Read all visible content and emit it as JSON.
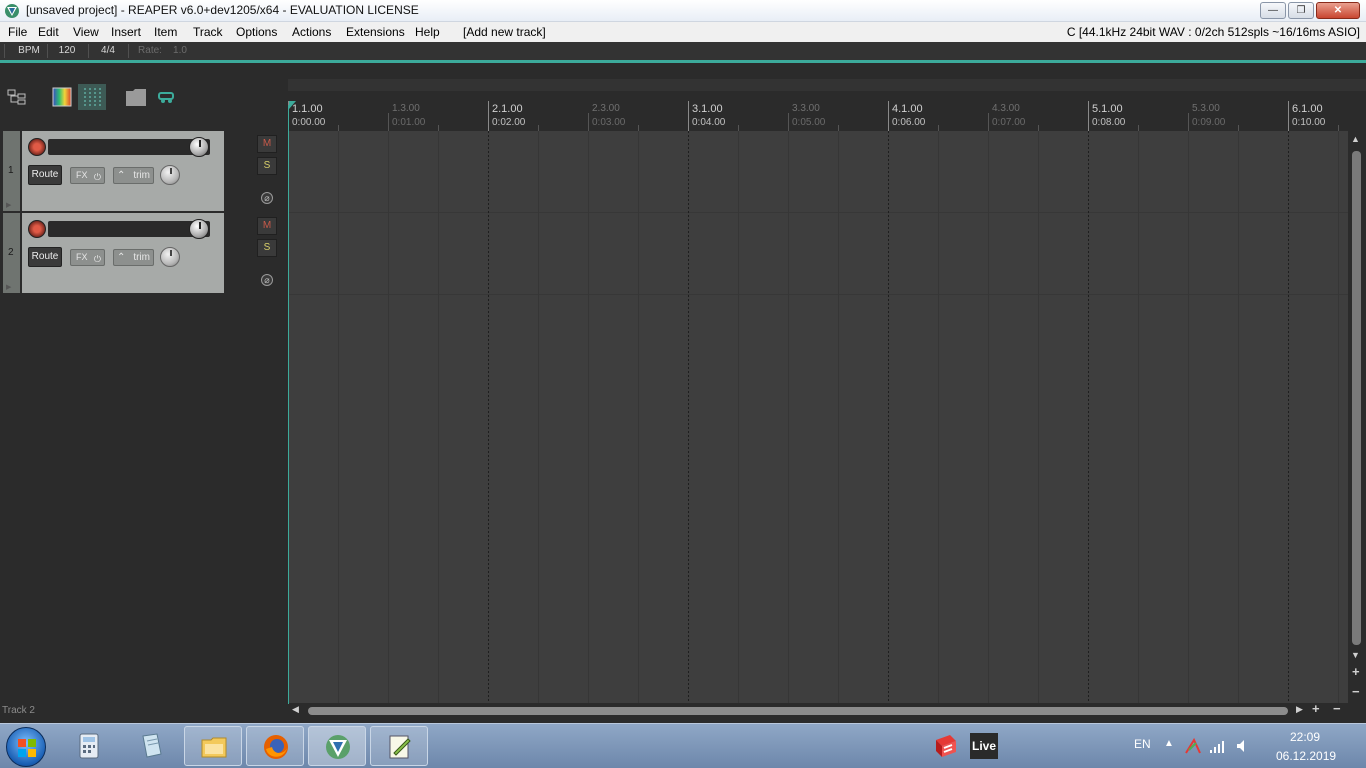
{
  "window": {
    "title": "[unsaved project] - REAPER v6.0+dev1205/x64 - EVALUATION LICENSE",
    "controls": {
      "minimize": "—",
      "maximize": "❐",
      "close": "✕"
    }
  },
  "menubar": {
    "items": [
      "File",
      "Edit",
      "View",
      "Insert",
      "Item",
      "Track",
      "Options",
      "Actions",
      "Extensions",
      "Help",
      "[Add new track]"
    ],
    "status": "C [44.1kHz 24bit WAV : 0/2ch 512spls ~16/16ms ASIO]"
  },
  "transport": {
    "bpm_label": "BPM",
    "bpm_value": "120",
    "time_signature": "4/4",
    "rate_label": "Rate:",
    "rate_value": "1.0"
  },
  "ruler": {
    "major": [
      {
        "bar": "1.1.00",
        "time": "0:00.00"
      },
      {
        "bar": "2.1.00",
        "time": "0:02.00"
      },
      {
        "bar": "3.1.00",
        "time": "0:04.00"
      },
      {
        "bar": "4.1.00",
        "time": "0:06.00"
      },
      {
        "bar": "5.1.00",
        "time": "0:08.00"
      },
      {
        "bar": "6.1.00",
        "time": "0:10.00"
      }
    ],
    "minor": [
      {
        "bar": "1.3.00",
        "time": "0:01.00"
      },
      {
        "bar": "2.3.00",
        "time": "0:03.00"
      },
      {
        "bar": "3.3.00",
        "time": "0:05.00"
      },
      {
        "bar": "4.3.00",
        "time": "0:07.00"
      },
      {
        "bar": "5.3.00",
        "time": "0:09.00"
      }
    ]
  },
  "tracks": [
    {
      "number": "1",
      "route_label": "Route",
      "fx_label": "FX",
      "fx_power": "⏻",
      "trim_label": "trim",
      "mute_label": "M",
      "solo_label": "S",
      "phase_label": "⌀"
    },
    {
      "number": "2",
      "route_label": "Route",
      "fx_label": "FX",
      "fx_power": "⏻",
      "trim_label": "trim",
      "mute_label": "M",
      "solo_label": "S",
      "phase_label": "⌀"
    }
  ],
  "status_bar": {
    "selected_track": "Track 2"
  },
  "taskbar": {
    "language": "EN",
    "time": "22:09",
    "date": "06.12.2019",
    "live_label": "Live"
  },
  "colors": {
    "accent_teal": "#3cab9b",
    "track_panel": "#a7aaa8",
    "arrange_bg": "#3e3e3e"
  }
}
